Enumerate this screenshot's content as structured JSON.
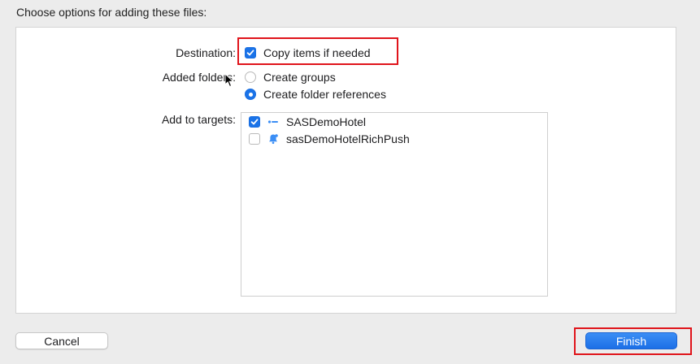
{
  "dialog": {
    "heading": "Choose options for adding these files:"
  },
  "destination": {
    "label": "Destination:",
    "copy_items_label": "Copy items if needed",
    "copy_items_checked": true
  },
  "added_folders": {
    "label": "Added folders:",
    "options": [
      {
        "label": "Create groups",
        "selected": false
      },
      {
        "label": "Create folder references",
        "selected": true
      }
    ]
  },
  "targets": {
    "label": "Add to targets:",
    "items": [
      {
        "label": "SASDemoHotel",
        "checked": true,
        "icon": "app-target-icon"
      },
      {
        "label": "sasDemoHotelRichPush",
        "checked": false,
        "icon": "extension-bell-icon"
      }
    ]
  },
  "buttons": {
    "cancel_label": "Cancel",
    "finish_label": "Finish"
  },
  "colors": {
    "accent": "#1a73e8",
    "highlight": "#e0141b"
  }
}
